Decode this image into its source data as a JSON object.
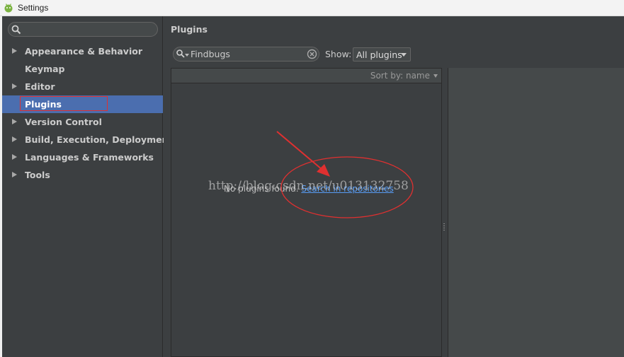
{
  "window": {
    "title": "Settings",
    "icon": "android-studio-icon"
  },
  "sidebar": {
    "search_value": "",
    "items": [
      {
        "label": "Appearance & Behavior",
        "expandable": true
      },
      {
        "label": "Keymap",
        "expandable": false
      },
      {
        "label": "Editor",
        "expandable": true
      },
      {
        "label": "Plugins",
        "expandable": false,
        "selected": true
      },
      {
        "label": "Version Control",
        "expandable": true
      },
      {
        "label": "Build, Execution, Deployment",
        "expandable": true
      },
      {
        "label": "Languages & Frameworks",
        "expandable": true
      },
      {
        "label": "Tools",
        "expandable": true
      }
    ]
  },
  "main": {
    "title": "Plugins",
    "search_value": "Findbugs",
    "show_label": "Show:",
    "show_value": "All plugins",
    "sort_label": "Sort by: name",
    "empty_text": "No plugins found.",
    "empty_link": "Search in repositories"
  },
  "watermark": "http://blog.csdn.net/u013132758",
  "colors": {
    "background": "#3c3f41",
    "selection": "#4b6eaf",
    "link": "#589df6",
    "annotation": "#e03030"
  }
}
